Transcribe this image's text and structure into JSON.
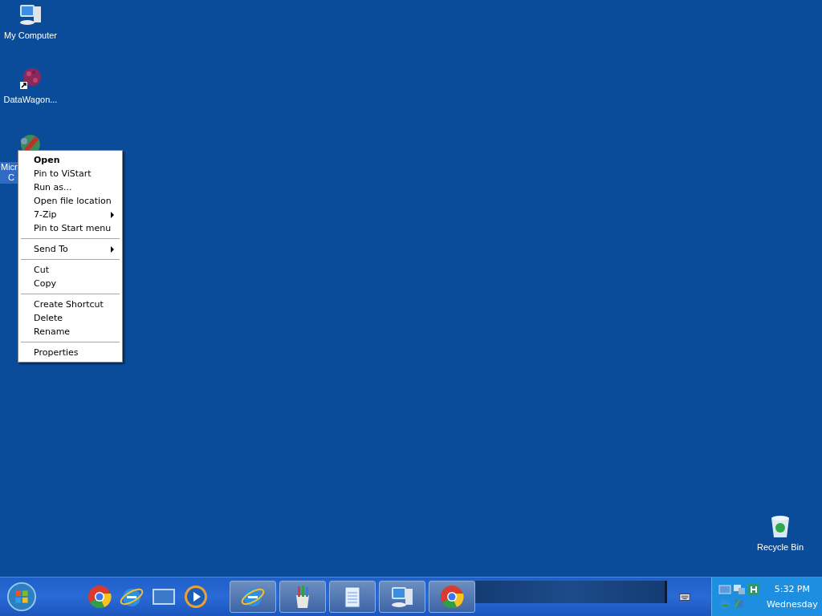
{
  "desktop_icons": [
    {
      "kind": "computer",
      "label": [
        "My Computer"
      ],
      "selected": false
    },
    {
      "kind": "network",
      "label": [
        "DataWagon..."
      ],
      "selected": false
    },
    {
      "kind": "app",
      "label": [
        "Micr",
        "C"
      ],
      "selected": true
    },
    {
      "kind": "recycle",
      "label": [
        "Recycle Bin"
      ],
      "selected": false
    }
  ],
  "context_menu": [
    {
      "kind": "item",
      "label": "Open",
      "default": true,
      "submenu": false
    },
    {
      "kind": "item",
      "label": "Pin to ViStart",
      "default": false,
      "submenu": false
    },
    {
      "kind": "item",
      "label": "Run as...",
      "default": false,
      "submenu": false
    },
    {
      "kind": "item",
      "label": "Open file location",
      "default": false,
      "submenu": false
    },
    {
      "kind": "item",
      "label": "7-Zip",
      "default": false,
      "submenu": true
    },
    {
      "kind": "item",
      "label": "Pin to Start menu",
      "default": false,
      "submenu": false
    },
    {
      "kind": "separator"
    },
    {
      "kind": "item",
      "label": "Send To",
      "default": false,
      "submenu": true
    },
    {
      "kind": "separator"
    },
    {
      "kind": "item",
      "label": "Cut",
      "default": false,
      "submenu": false
    },
    {
      "kind": "item",
      "label": "Copy",
      "default": false,
      "submenu": false
    },
    {
      "kind": "separator"
    },
    {
      "kind": "item",
      "label": "Create Shortcut",
      "default": false,
      "submenu": false
    },
    {
      "kind": "item",
      "label": "Delete",
      "default": false,
      "submenu": false
    },
    {
      "kind": "item",
      "label": "Rename",
      "default": false,
      "submenu": false
    },
    {
      "kind": "separator"
    },
    {
      "kind": "item",
      "label": "Properties",
      "default": false,
      "submenu": false
    }
  ],
  "taskbar": {
    "quick_launch": [
      {
        "kind": "chrome"
      },
      {
        "kind": "ie"
      },
      {
        "kind": "desktop"
      },
      {
        "kind": "media"
      }
    ],
    "tasks": [
      {
        "kind": "ie"
      },
      {
        "kind": "paint"
      },
      {
        "kind": "notepad"
      },
      {
        "kind": "computer"
      },
      {
        "kind": "chrome"
      }
    ],
    "clock": {
      "time": "5:32 PM",
      "day": "Wednesday"
    }
  }
}
